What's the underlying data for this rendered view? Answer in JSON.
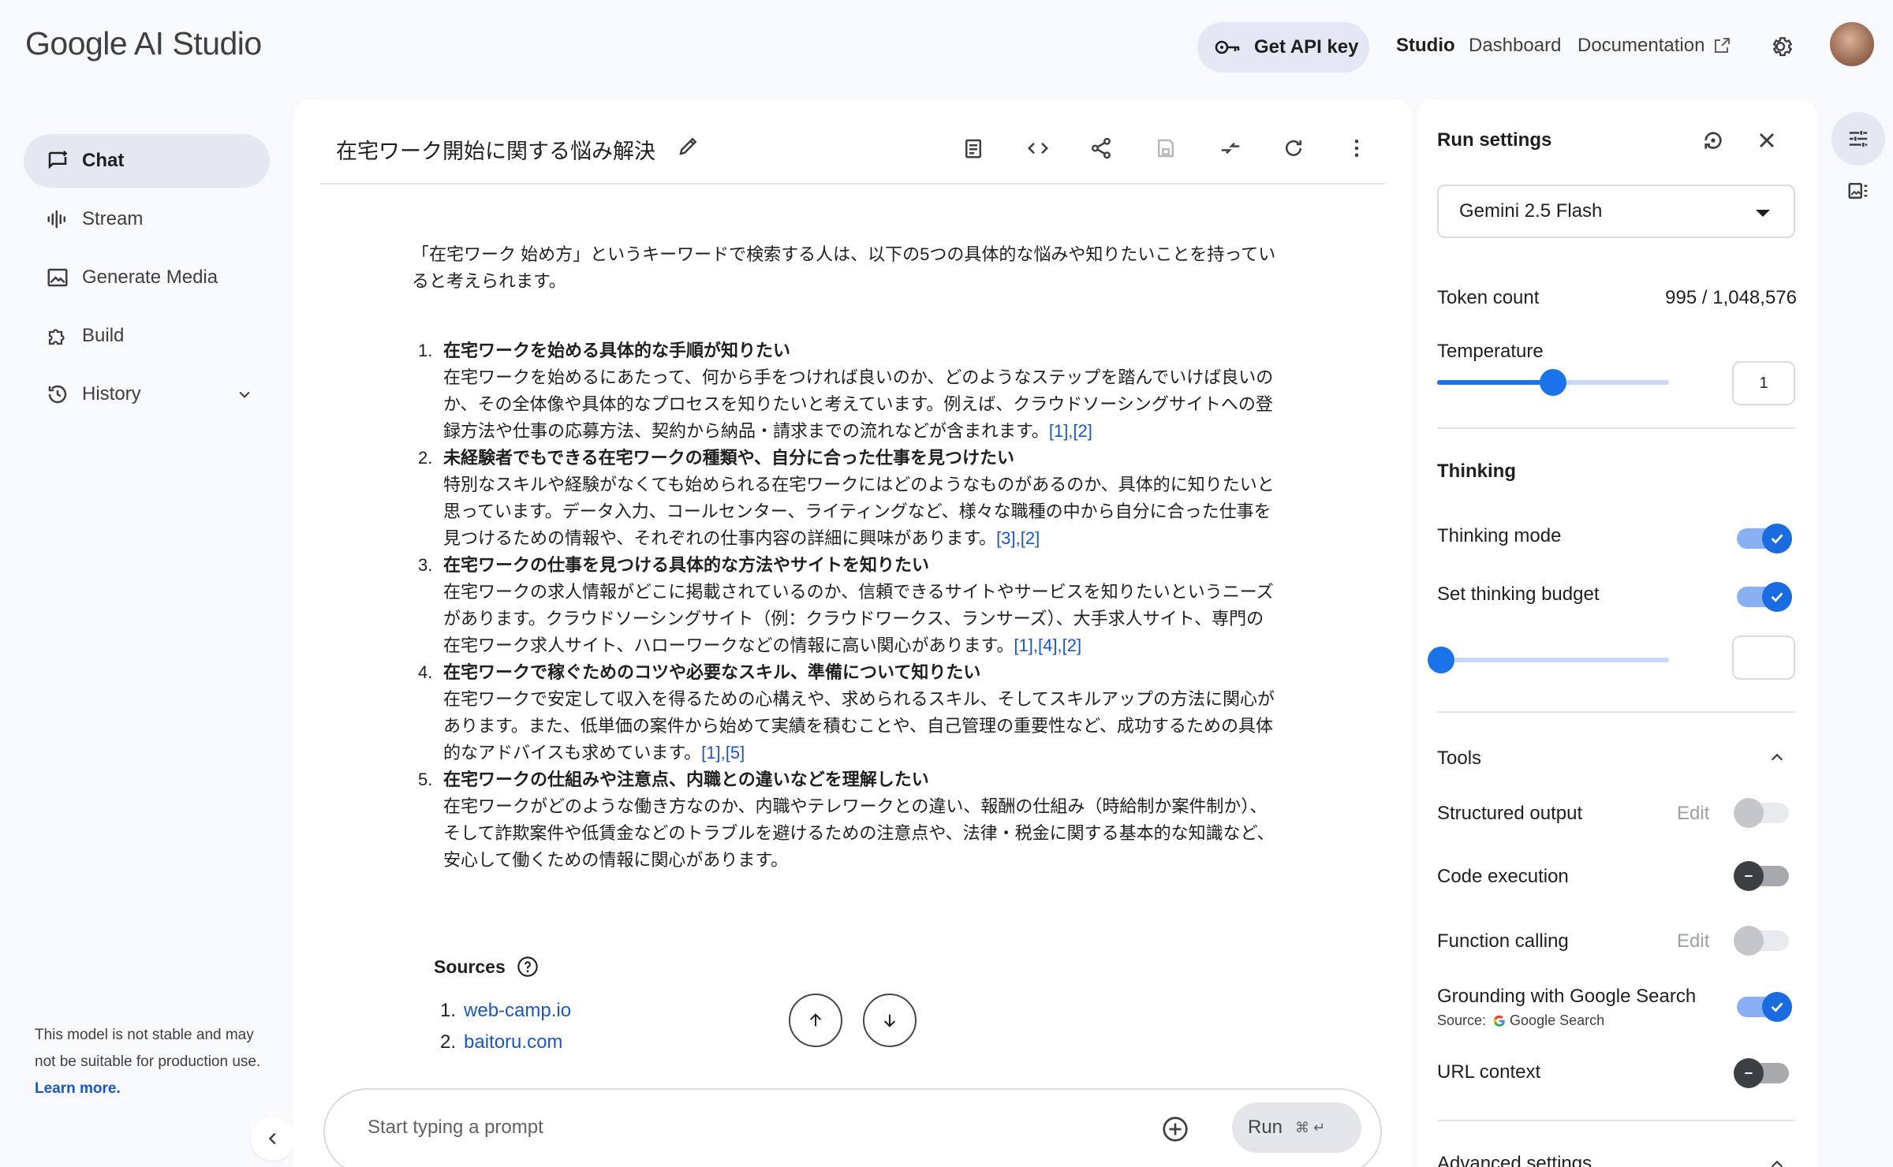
{
  "header": {
    "logo": "Google AI Studio",
    "api_key_label": "Get API key",
    "nav": {
      "studio": "Studio",
      "dashboard": "Dashboard",
      "documentation": "Documentation"
    }
  },
  "sidebar": {
    "items": [
      {
        "label": "Chat",
        "icon": "chat-icon"
      },
      {
        "label": "Stream",
        "icon": "stream-icon"
      },
      {
        "label": "Generate Media",
        "icon": "media-icon"
      },
      {
        "label": "Build",
        "icon": "build-icon"
      },
      {
        "label": "History",
        "icon": "history-icon"
      }
    ],
    "note": "This model is not stable and may not be suitable for production use.",
    "learn_more": "Learn more."
  },
  "chat": {
    "title": "在宅ワーク開始に関する悩み解決",
    "intro": "「在宅ワーク 始め方」というキーワードで検索する人は、以下の5つの具体的な悩みや知りたいことを持っていると考えられます。",
    "items": [
      {
        "num": "1.",
        "title": "在宅ワークを始める具体的な手順が知りたい",
        "body": "在宅ワークを始めるにあたって、何から手をつければ良いのか、どのようなステップを踏んでいけば良いのか、その全体像や具体的なプロセスを知りたいと考えています。例えば、クラウドソーシングサイトへの登録方法や仕事の応募方法、契約から納品・請求までの流れなどが含まれます。",
        "cites": [
          "1",
          "2"
        ]
      },
      {
        "num": "2.",
        "title": "未経験者でもできる在宅ワークの種類や、自分に合った仕事を見つけたい",
        "body": "特別なスキルや経験がなくても始められる在宅ワークにはどのようなものがあるのか、具体的に知りたいと思っています。データ入力、コールセンター、ライティングなど、様々な職種の中から自分に合った仕事を見つけるための情報や、それぞれの仕事内容の詳細に興味があります。",
        "cites": [
          "3",
          "2"
        ]
      },
      {
        "num": "3.",
        "title": "在宅ワークの仕事を見つける具体的な方法やサイトを知りたい",
        "body": "在宅ワークの求人情報がどこに掲載されているのか、信頼できるサイトやサービスを知りたいというニーズがあります。クラウドソーシングサイト（例：クラウドワークス、ランサーズ）、大手求人サイト、専門の在宅ワーク求人サイト、ハローワークなどの情報に高い関心があります。",
        "cites": [
          "1",
          "4",
          "2"
        ]
      },
      {
        "num": "4.",
        "title": "在宅ワークで稼ぐためのコツや必要なスキル、準備について知りたい",
        "body": "在宅ワークで安定して収入を得るための心構えや、求められるスキル、そしてスキルアップの方法に関心があります。また、低単価の案件から始めて実績を積むことや、自己管理の重要性など、成功するための具体的なアドバイスも求めています。",
        "cites": [
          "1",
          "5"
        ]
      },
      {
        "num": "5.",
        "title": "在宅ワークの仕組みや注意点、内職との違いなどを理解したい",
        "body": "在宅ワークがどのような働き方なのか、内職やテレワークとの違い、報酬の仕組み（時給制か案件制か）、そして詐欺案件や低賃金などのトラブルを避けるための注意点や、法律・税金に関する基本的な知識など、安心して働くための情報に関心があります。",
        "cites": []
      }
    ],
    "sources_label": "Sources",
    "sources": [
      {
        "num": "1.",
        "label": "web-camp.io"
      },
      {
        "num": "2.",
        "label": "baitoru.com"
      }
    ],
    "prompt_placeholder": "Start typing a prompt",
    "run_label": "Run",
    "run_shortcut": "⌘ ↵"
  },
  "run_settings": {
    "title": "Run settings",
    "model": "Gemini 2.5 Flash",
    "token_label": "Token count",
    "token_value": "995 / 1,048,576",
    "temperature_label": "Temperature",
    "temperature_value": "1",
    "temperature_fraction": 0.5,
    "thinking_label": "Thinking",
    "thinking_mode_label": "Thinking mode",
    "thinking_mode_on": true,
    "thinking_budget_label": "Set thinking budget",
    "thinking_budget_on": true,
    "thinking_budget_value": "",
    "tools_label": "Tools",
    "tools": [
      {
        "label": "Structured output",
        "edit": "Edit",
        "state": "disabled"
      },
      {
        "label": "Code execution",
        "edit": "",
        "state": "off"
      },
      {
        "label": "Function calling",
        "edit": "Edit",
        "state": "disabled"
      },
      {
        "label": "Grounding with Google Search",
        "edit": "",
        "state": "on"
      },
      {
        "label": "URL context",
        "edit": "",
        "state": "off"
      }
    ],
    "grounding_source_prefix": "Source:",
    "grounding_source": "Google Search",
    "advanced_label": "Advanced settings"
  },
  "colors": {
    "accent": "#1a73e8",
    "link": "#1a56c8",
    "sidebar_active": "#e4e8f2"
  }
}
